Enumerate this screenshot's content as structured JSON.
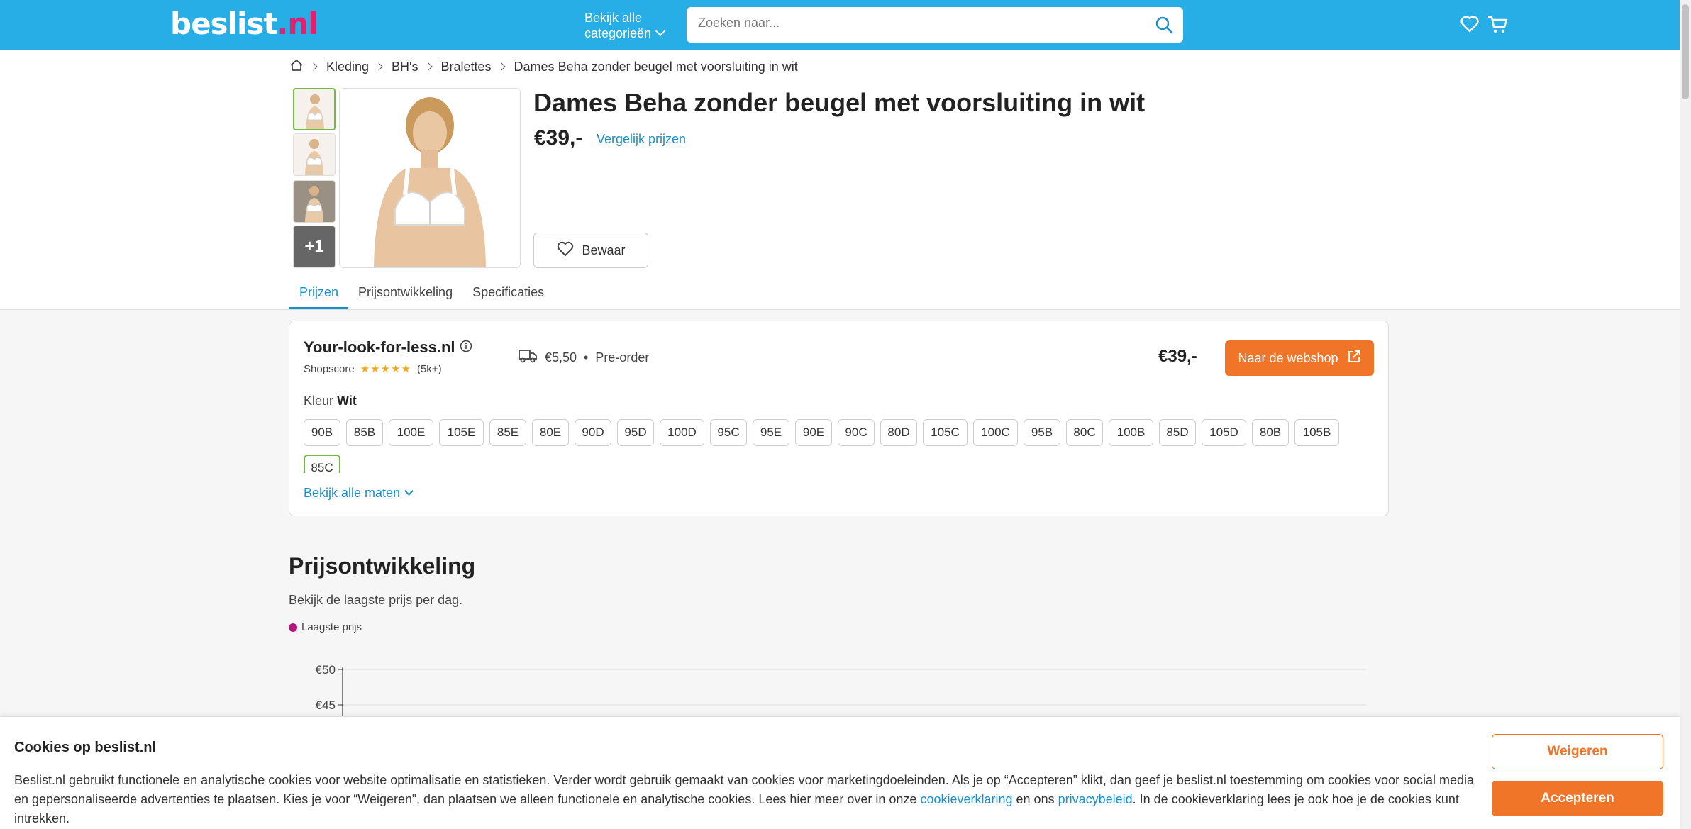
{
  "header": {
    "logo_main": "beslist",
    "logo_tld": ".nl",
    "all_categories_line1": "Bekijk alle",
    "all_categories_line2": "categorieën",
    "search_placeholder": "Zoeken naar..."
  },
  "breadcrumb": [
    "Kleding",
    "BH's",
    "Bralettes",
    "Dames Beha zonder beugel met voorsluiting in wit"
  ],
  "product": {
    "title": "Dames Beha zonder beugel met voorsluiting in wit",
    "price": "€39,-",
    "compare_label": "Vergelijk prijzen",
    "save_label": "Bewaar",
    "more_images_label": "+1"
  },
  "tabs": [
    "Prijzen",
    "Prijsontwikkeling",
    "Specificaties"
  ],
  "offer": {
    "shop_name": "Your-look-for-less.nl",
    "shopscore_label": "Shopscore",
    "stars": "★★★★★",
    "rating": 4.5,
    "review_count": "(5k+)",
    "shipping_cost": "€5,50",
    "separator": "•",
    "availability": "Pre-order",
    "price": "€39,-",
    "shop_button": "Naar de webshop",
    "color_label": "Kleur",
    "color_value": "Wit",
    "sizes": [
      "90B",
      "85B",
      "100E",
      "105E",
      "85E",
      "80E",
      "90D",
      "95D",
      "100D",
      "95C",
      "95E",
      "90E",
      "90C",
      "80D",
      "105C",
      "100C",
      "95B",
      "80C",
      "100B",
      "85D",
      "105D",
      "80B",
      "105B",
      "85C"
    ],
    "selected_size": "85C",
    "more_sizes_label": "Bekijk alle maten"
  },
  "price_development": {
    "title": "Prijsontwikkeling",
    "subtitle": "Bekijk de laagste prijs per dag.",
    "legend_label": "Laagste prijs",
    "series_color": "#b5177d"
  },
  "chart_data": {
    "type": "line",
    "series": [
      {
        "name": "Laagste prijs",
        "values": []
      }
    ],
    "y_ticks": [
      "€50",
      "€45"
    ],
    "ylim_visible": [
      45,
      50
    ]
  },
  "cookie": {
    "title": "Cookies op beslist.nl",
    "text_1": "Beslist.nl gebruikt functionele en analytische cookies voor website optimalisatie en statistieken. Verder wordt gebruik gemaakt van cookies voor marketingdoeleinden. Als je op “Accepteren” klikt, dan geef je beslist.nl toestemming om cookies voor social media en gepersonaliseerde advertenties te plaatsen. Kies je voor “Weigeren”, dan plaatsen we alleen functionele en analytische cookies. Lees hier meer over in onze",
    "link_1": "cookieverklaring",
    "text_2": "en ons",
    "link_2": "privacybeleid",
    "text_3": ". In de cookieverklaring lees je ook hoe je de cookies kunt intrekken.",
    "decline_label": "Weigeren",
    "accept_label": "Accepteren"
  },
  "colors": {
    "header_bg": "#27aee6",
    "accent_orange": "#f07528",
    "link_blue": "#1a8fc9",
    "selected_green": "#6bbf3a",
    "logo_tld": "#e61e6e"
  }
}
